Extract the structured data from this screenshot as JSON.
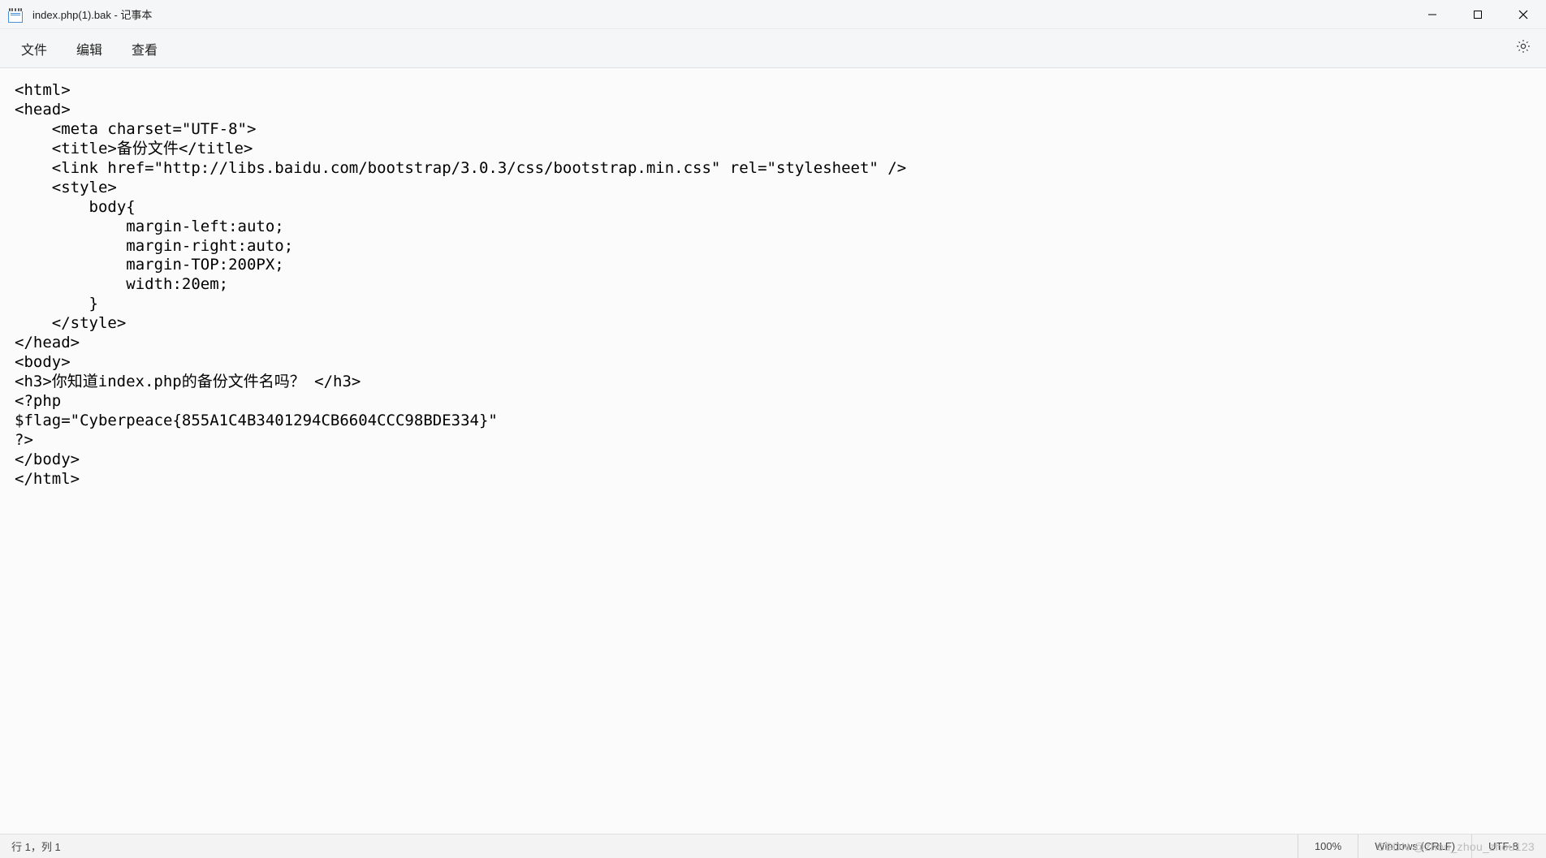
{
  "titlebar": {
    "title": "index.php(1).bak - 记事本"
  },
  "menu": {
    "file": "文件",
    "edit": "编辑",
    "view": "查看"
  },
  "editor": {
    "content": "<html>\n<head>\n    <meta charset=\"UTF-8\">\n    <title>备份文件</title>\n    <link href=\"http://libs.baidu.com/bootstrap/3.0.3/css/bootstrap.min.css\" rel=\"stylesheet\" />\n    <style>\n        body{\n            margin-left:auto;\n            margin-right:auto;\n            margin-TOP:200PX;\n            width:20em;\n        }\n    </style>\n</head>\n<body>\n<h3>你知道index.php的备份文件名吗？ </h3>\n<?php\n$flag=\"Cyberpeace{855A1C4B3401294CB6604CCC98BDE334}\"\n?>\n</body>\n</html>"
  },
  "statusbar": {
    "cursor": "行 1，列 1",
    "zoom": "100%",
    "line_ending": "Windows (CRLF)",
    "encoding": "UTF-8"
  },
  "watermark": "CSDN @zhou_zhou_zhou123"
}
